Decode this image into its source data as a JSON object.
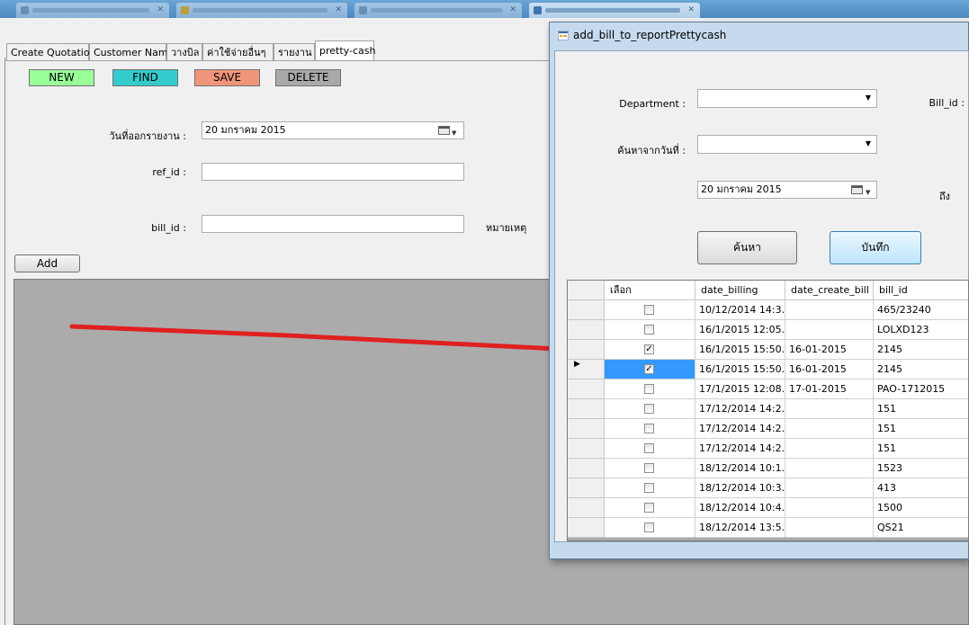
{
  "main": {
    "tabs": [
      "Create Quotation",
      "Customer Name",
      "วางบิล",
      "ค่าใช้จ่ายอื่นๆ",
      "รายงาน",
      "pretty-cash"
    ],
    "active_tab": "pretty-cash",
    "buttons": {
      "new": "NEW",
      "find": "FIND",
      "save": "SAVE",
      "delete": "DELETE",
      "add": "Add"
    },
    "colors": {
      "new": "#99ff99",
      "find": "#33cccc",
      "save": "#f0957a",
      "delete": "#a9a9a9"
    },
    "fields": {
      "report_date_label": "วันที่ออกรายงาน :",
      "report_date_value": "20   มกราคม   2015",
      "ref_id_label": "ref_id :",
      "bill_id_label": "bill_id :",
      "remark_label": "หมายเหตุ"
    }
  },
  "dialog": {
    "title": "add_bill_to_reportPrettycash",
    "department_label": "Department :",
    "bill_id_label": "Bill_id :",
    "search_from_date_label": "ค้นหาจากวันที่ :",
    "date_value": "20   มกราคม   2015",
    "to_label": "ถึง",
    "search_button": "ค้นหา",
    "save_button": "บันทึก",
    "grid": {
      "headers": [
        "เลือก",
        "date_billing",
        "date_create_bill",
        "bill_id"
      ],
      "rows": [
        {
          "checked": false,
          "date_billing": "10/12/2014 14:3...",
          "date_create_bill": "",
          "bill_id": "465/23240"
        },
        {
          "checked": false,
          "date_billing": "16/1/2015 12:05...",
          "date_create_bill": "",
          "bill_id": "LOLXD123"
        },
        {
          "checked": true,
          "date_billing": "16/1/2015 15:50...",
          "date_create_bill": "16-01-2015",
          "bill_id": "2145"
        },
        {
          "checked": true,
          "date_billing": "16/1/2015 15:50...",
          "date_create_bill": "16-01-2015",
          "bill_id": "2145",
          "current": true
        },
        {
          "checked": false,
          "date_billing": "17/1/2015 12:08...",
          "date_create_bill": "17-01-2015",
          "bill_id": "PAO-1712015"
        },
        {
          "checked": false,
          "date_billing": "17/12/2014 14:2...",
          "date_create_bill": "",
          "bill_id": "151"
        },
        {
          "checked": false,
          "date_billing": "17/12/2014 14:2...",
          "date_create_bill": "",
          "bill_id": "151"
        },
        {
          "checked": false,
          "date_billing": "17/12/2014 14:2...",
          "date_create_bill": "",
          "bill_id": "151"
        },
        {
          "checked": false,
          "date_billing": "18/12/2014 10:1...",
          "date_create_bill": "",
          "bill_id": "1523"
        },
        {
          "checked": false,
          "date_billing": "18/12/2014 10:3...",
          "date_create_bill": "",
          "bill_id": "413"
        },
        {
          "checked": false,
          "date_billing": "18/12/2014 10:4...",
          "date_create_bill": "",
          "bill_id": "1500"
        },
        {
          "checked": false,
          "date_billing": "18/12/2014 13:5...",
          "date_create_bill": "",
          "bill_id": "QS21"
        }
      ]
    }
  },
  "annotation_color": "#e02020"
}
